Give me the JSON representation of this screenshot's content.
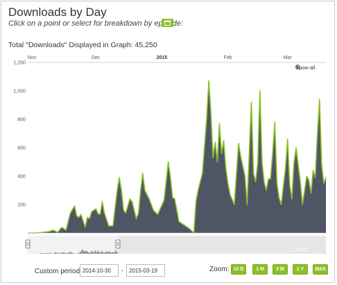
{
  "header": {
    "title": "Downloads by Day",
    "subtitle": "Click on a point or select for breakdown by episode:",
    "breakdown_icon": "calendar-icon"
  },
  "total": {
    "text": "Total \"Downloads\" Displayed in Graph: 45,250"
  },
  "chart_controls": {
    "show_all_label": "Show all",
    "show_all_icon": "zoom-out-icon"
  },
  "colors": {
    "area_fill": "#4f5565",
    "line": "#8cbf26",
    "accent": "#8cbf26",
    "navigator_fill": "#9a9a9a"
  },
  "chart_data": {
    "type": "area",
    "title": "",
    "xlabel": "",
    "ylabel": "",
    "x_tick_labels": [
      {
        "label": "Nov",
        "date": "2014-11-01",
        "bold": false
      },
      {
        "label": "Dec",
        "date": "2014-12-01",
        "bold": false
      },
      {
        "label": "2015",
        "date": "2015-01-01",
        "bold": true
      },
      {
        "label": "Feb",
        "date": "2015-02-01",
        "bold": false
      },
      {
        "label": "Mar",
        "date": "2015-03-01",
        "bold": false
      }
    ],
    "y_ticks": [
      200,
      400,
      600,
      800,
      "1,000",
      "1,200"
    ],
    "ylim": [
      0,
      1200
    ],
    "grid": false,
    "series": [
      {
        "values": [
          [
            "2014-10-30",
            0
          ],
          [
            "2014-11-03",
            0
          ],
          [
            "2014-11-06",
            5
          ],
          [
            "2014-11-09",
            10
          ],
          [
            "2014-11-11",
            20
          ],
          [
            "2014-11-13",
            5
          ],
          [
            "2014-11-15",
            40
          ],
          [
            "2014-11-17",
            20
          ],
          [
            "2014-11-19",
            140
          ],
          [
            "2014-11-21",
            190
          ],
          [
            "2014-11-22",
            120
          ],
          [
            "2014-11-23",
            110
          ],
          [
            "2014-11-24",
            130
          ],
          [
            "2014-11-26",
            40
          ],
          [
            "2014-11-27",
            110
          ],
          [
            "2014-11-28",
            100
          ],
          [
            "2014-11-29",
            150
          ],
          [
            "2014-12-01",
            170
          ],
          [
            "2014-12-02",
            135
          ],
          [
            "2014-12-03",
            130
          ],
          [
            "2014-12-04",
            220
          ],
          [
            "2014-12-05",
            140
          ],
          [
            "2014-12-07",
            50
          ],
          [
            "2014-12-09",
            50
          ],
          [
            "2014-12-11",
            300
          ],
          [
            "2014-12-12",
            390
          ],
          [
            "2014-12-13",
            300
          ],
          [
            "2014-12-14",
            160
          ],
          [
            "2014-12-15",
            140
          ],
          [
            "2014-12-17",
            240
          ],
          [
            "2014-12-18",
            220
          ],
          [
            "2014-12-20",
            100
          ],
          [
            "2014-12-21",
            140
          ],
          [
            "2014-12-22",
            300
          ],
          [
            "2014-12-23",
            420
          ],
          [
            "2014-12-24",
            300
          ],
          [
            "2014-12-26",
            240
          ],
          [
            "2014-12-28",
            160
          ],
          [
            "2014-12-30",
            130
          ],
          [
            "2015-01-02",
            230
          ],
          [
            "2015-01-03",
            360
          ],
          [
            "2015-01-04",
            500
          ],
          [
            "2015-01-05",
            390
          ],
          [
            "2015-01-06",
            250
          ],
          [
            "2015-01-07",
            240
          ],
          [
            "2015-01-09",
            80
          ],
          [
            "2015-01-11",
            60
          ],
          [
            "2015-01-14",
            30
          ],
          [
            "2015-01-16",
            0
          ],
          [
            "2015-01-17",
            220
          ],
          [
            "2015-01-18",
            300
          ],
          [
            "2015-01-20",
            420
          ],
          [
            "2015-01-22",
            800
          ],
          [
            "2015-01-23",
            1070
          ],
          [
            "2015-01-24",
            850
          ],
          [
            "2015-01-25",
            530
          ],
          [
            "2015-01-26",
            640
          ],
          [
            "2015-01-27",
            500
          ],
          [
            "2015-01-28",
            770
          ],
          [
            "2015-01-29",
            560
          ],
          [
            "2015-01-30",
            650
          ],
          [
            "2015-01-31",
            460
          ],
          [
            "2015-02-01",
            350
          ],
          [
            "2015-02-02",
            270
          ],
          [
            "2015-02-04",
            200
          ],
          [
            "2015-02-06",
            630
          ],
          [
            "2015-02-07",
            540
          ],
          [
            "2015-02-09",
            400
          ],
          [
            "2015-02-10",
            200
          ],
          [
            "2015-02-12",
            920
          ],
          [
            "2015-02-13",
            420
          ],
          [
            "2015-02-14",
            360
          ],
          [
            "2015-02-15",
            490
          ],
          [
            "2015-02-16",
            1000
          ],
          [
            "2015-02-17",
            500
          ],
          [
            "2015-02-18",
            360
          ],
          [
            "2015-02-19",
            300
          ],
          [
            "2015-02-20",
            380
          ],
          [
            "2015-02-21",
            380
          ],
          [
            "2015-02-22",
            560
          ],
          [
            "2015-02-23",
            780
          ],
          [
            "2015-02-24",
            350
          ],
          [
            "2015-02-25",
            250
          ],
          [
            "2015-02-26",
            200
          ],
          [
            "2015-02-28",
            450
          ],
          [
            "2015-03-01",
            660
          ],
          [
            "2015-03-02",
            340
          ],
          [
            "2015-03-03",
            240
          ],
          [
            "2015-03-04",
            490
          ],
          [
            "2015-03-05",
            600
          ],
          [
            "2015-03-07",
            360
          ],
          [
            "2015-03-08",
            200
          ],
          [
            "2015-03-10",
            400
          ],
          [
            "2015-03-11",
            370
          ],
          [
            "2015-03-12",
            280
          ],
          [
            "2015-03-13",
            440
          ],
          [
            "2015-03-14",
            390
          ],
          [
            "2015-03-15",
            690
          ],
          [
            "2015-03-16",
            940
          ],
          [
            "2015-03-17",
            480
          ],
          [
            "2015-03-18",
            350
          ],
          [
            "2015-03-19",
            390
          ]
        ]
      }
    ],
    "navigator": {
      "year_label": "2015"
    }
  },
  "custom_period": {
    "label": "Custom period:",
    "start": "2014-10-30",
    "end": "2015-03-19",
    "separator": "-"
  },
  "zoom": {
    "label": "Zoom:",
    "buttons": [
      "10 D",
      "1 M",
      "3 M",
      "1 Y",
      "MAX"
    ]
  }
}
